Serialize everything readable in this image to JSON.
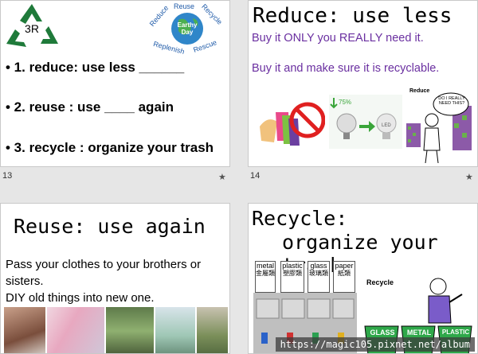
{
  "slides": [
    {
      "number": "13",
      "logo_label": "3R",
      "badge_words": [
        "Reduce",
        "Reuse",
        "Recycle",
        "Replenish",
        "Rescue"
      ],
      "badge_center": "Earthy Day",
      "items": [
        "• 1. reduce:  use less ______",
        "• 2. reuse : use ____ again",
        "• 3. recycle : organize your trash"
      ]
    },
    {
      "number": "14",
      "title": "Reduce:  use less",
      "lines": [
        "Buy it ONLY you REALLY need it.",
        "Buy it and make sure it is recyclable."
      ],
      "bulb_percent": "75%",
      "bulb_label": "LED",
      "cartoon_label": "Reduce",
      "speech_bubble": "DO I REALLY NEED THIS?"
    },
    {
      "title": "Reuse: use again",
      "body_lines": [
        "Pass your clothes to your brothers or sisters.",
        "DIY old things into new one."
      ]
    },
    {
      "title_line1": "Recycle:",
      "title_line2": "organize your trash",
      "bins": [
        {
          "en": "metal",
          "zh": "金屬類"
        },
        {
          "en": "plastic",
          "zh": "塑膠類"
        },
        {
          "en": "glass",
          "zh": "玻璃類"
        },
        {
          "en": "paper",
          "zh": "紙類"
        }
      ],
      "cartoon_label": "Recycle",
      "can_labels": [
        "GLASS",
        "METAL",
        "PLASTIC"
      ]
    }
  ],
  "watermark": "https://magic105.pixnet.net/album",
  "star_glyph": "★"
}
